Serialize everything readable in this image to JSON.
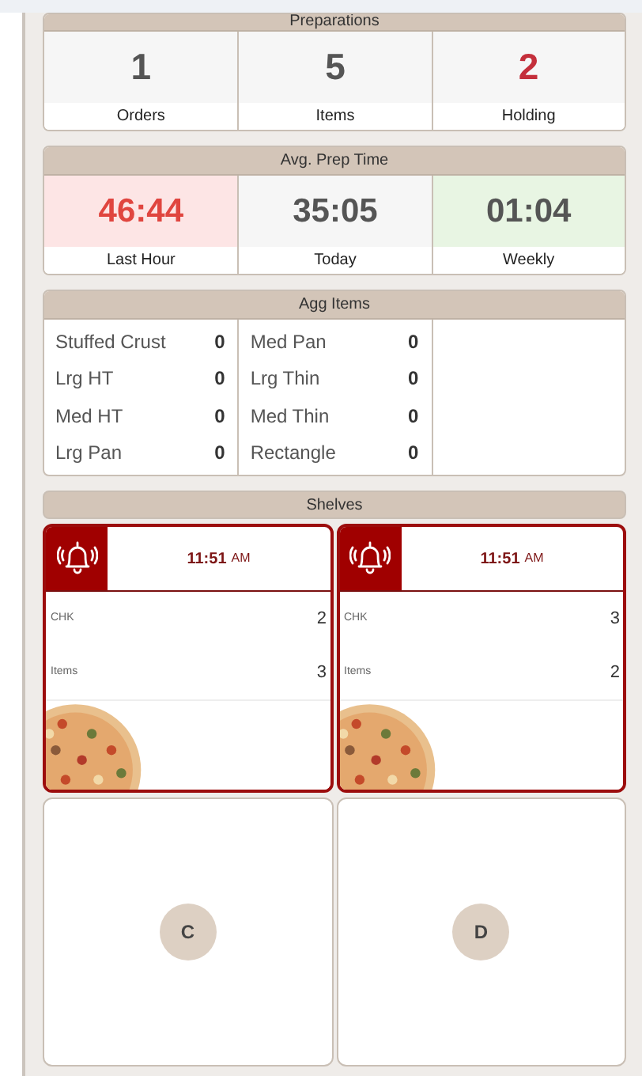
{
  "preparations": {
    "title": "Preparations",
    "stats": [
      {
        "value": "1",
        "label": "Orders",
        "kind": "plain"
      },
      {
        "value": "5",
        "label": "Items",
        "kind": "plain"
      },
      {
        "value": "2",
        "label": "Holding",
        "kind": "alert"
      }
    ]
  },
  "avg_prep_time": {
    "title": "Avg. Prep Time",
    "stats": [
      {
        "value": "46:44",
        "label": "Last Hour",
        "kind": "slow"
      },
      {
        "value": "35:05",
        "label": "Today",
        "kind": "plain"
      },
      {
        "value": "01:04",
        "label": "Weekly",
        "kind": "fast"
      }
    ]
  },
  "agg_items": {
    "title": "Agg Items",
    "columns": [
      [
        {
          "name": "Stuffed Crust",
          "count": "0"
        },
        {
          "name": "Lrg HT",
          "count": "0"
        },
        {
          "name": "Med HT",
          "count": "0"
        },
        {
          "name": "Lrg Pan",
          "count": "0"
        }
      ],
      [
        {
          "name": "Med Pan",
          "count": "0"
        },
        {
          "name": "Lrg Thin",
          "count": "0"
        },
        {
          "name": "Med Thin",
          "count": "0"
        },
        {
          "name": "Rectangle",
          "count": "0"
        }
      ]
    ]
  },
  "shelves": {
    "title": "Shelves",
    "slots": [
      {
        "kind": "order",
        "time": "11:51",
        "meridiem": "AM",
        "rows": [
          {
            "label": "CHK",
            "value": "2"
          },
          {
            "label": "Items",
            "value": "3"
          }
        ]
      },
      {
        "kind": "order",
        "time": "11:51",
        "meridiem": "AM",
        "rows": [
          {
            "label": "CHK",
            "value": "3"
          },
          {
            "label": "Items",
            "value": "2"
          }
        ]
      },
      {
        "kind": "empty",
        "letter": "C"
      },
      {
        "kind": "empty",
        "letter": "D"
      }
    ]
  }
}
